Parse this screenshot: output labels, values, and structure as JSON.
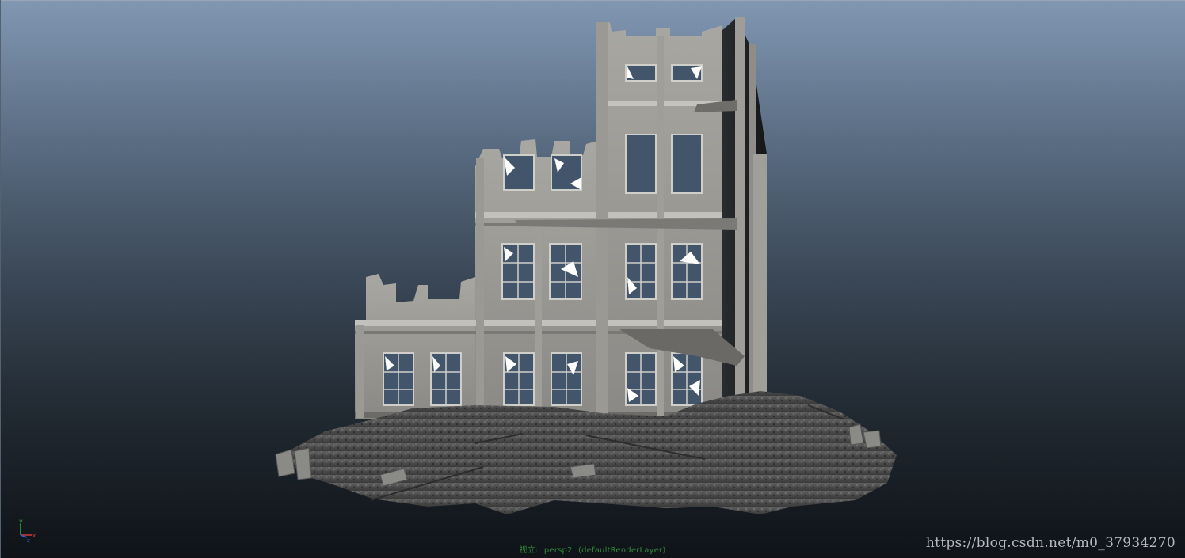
{
  "viewport": {
    "camera_prefix": "视立:",
    "camera_name": "persp2",
    "render_layer": "(defaultRenderLayer)"
  },
  "axis_gizmo": {
    "y_label": "y",
    "x_label": "x",
    "z_label": "z"
  },
  "watermark": "https://blog.csdn.net/m0_37934270",
  "colors": {
    "bg_top": "#8197b2",
    "bg_bottom": "#0f1318",
    "camera_label": "#2e8b3a",
    "axis_y": "#2ea83a",
    "axis_x": "#d23a3a",
    "axis_z": "#3a5bd2"
  },
  "scene_object": "ruined-building-model"
}
